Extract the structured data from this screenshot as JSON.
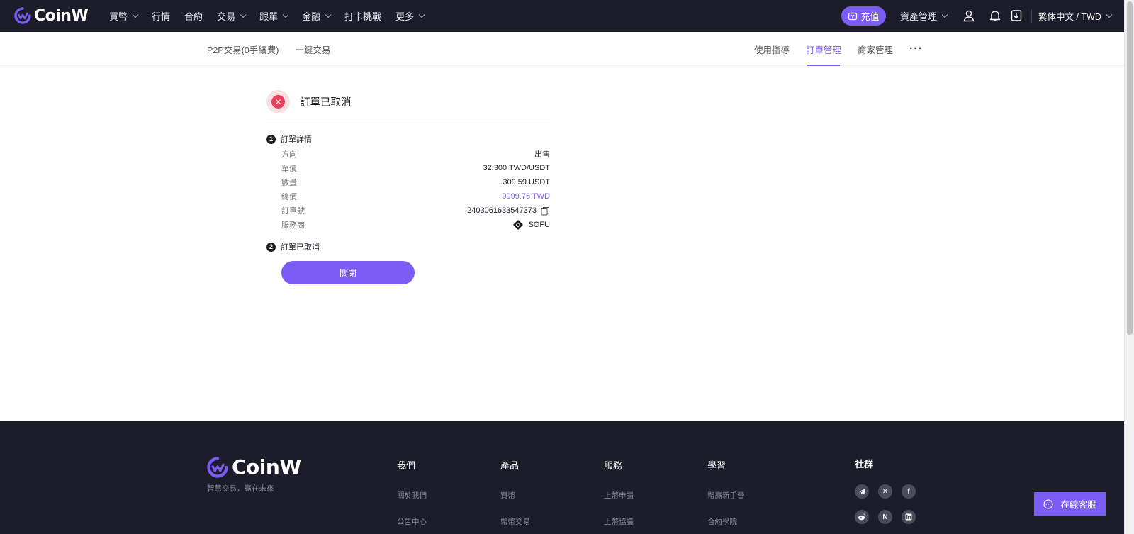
{
  "header": {
    "logo": "CoinW",
    "nav": [
      {
        "label": "買幣",
        "has_dropdown": true
      },
      {
        "label": "行情",
        "has_dropdown": false
      },
      {
        "label": "合約",
        "has_dropdown": false
      },
      {
        "label": "交易",
        "has_dropdown": true
      },
      {
        "label": "跟單",
        "has_dropdown": true
      },
      {
        "label": "金融",
        "has_dropdown": true
      },
      {
        "label": "打卡挑戰",
        "has_dropdown": false
      },
      {
        "label": "更多",
        "has_dropdown": true
      }
    ],
    "deposit_label": "充值",
    "asset_label": "資產管理",
    "language_label": "繁体中文 / TWD"
  },
  "subnav": {
    "left": [
      "P2P交易(0手續費)",
      "一鍵交易"
    ],
    "right": [
      {
        "label": "使用指導",
        "active": false
      },
      {
        "label": "訂單管理",
        "active": true
      },
      {
        "label": "商家管理",
        "active": false
      }
    ],
    "more": "···"
  },
  "order": {
    "status_title": "訂單已取消",
    "step1": {
      "num": "1",
      "title": "訂單詳情"
    },
    "details": [
      {
        "label": "方向",
        "value": "出售"
      },
      {
        "label": "單價",
        "value": "32.300 TWD/USDT"
      },
      {
        "label": "數量",
        "value": "309.59 USDT"
      },
      {
        "label": "總價",
        "value": "9999.76 TWD"
      },
      {
        "label": "訂單號",
        "value": "2403061633547373"
      },
      {
        "label": "服務商",
        "value": "SOFU"
      }
    ],
    "step2": {
      "num": "2",
      "title": "訂單已取消"
    },
    "close_label": "關閉"
  },
  "footer": {
    "logo": "CoinW",
    "slogan": "智慧交易，贏在未來",
    "columns": [
      {
        "title": "我們",
        "links": [
          "關於我們",
          "公告中心"
        ]
      },
      {
        "title": "產品",
        "links": [
          "買幣",
          "幣幣交易"
        ]
      },
      {
        "title": "服務",
        "links": [
          "上幣申請",
          "上幣協議"
        ]
      },
      {
        "title": "學習",
        "links": [
          "幣贏新手營",
          "合約學院"
        ]
      }
    ],
    "social_title": "社群",
    "social_icons": [
      "telegram-icon",
      "x-icon",
      "facebook-icon",
      "weibo-icon",
      "naver-icon",
      "linkedin-icon"
    ]
  },
  "support_label": "在線客服",
  "colors": {
    "accent": "#7b5cf5",
    "nav_bg": "#1c1c2a",
    "error": "#e8415a"
  }
}
